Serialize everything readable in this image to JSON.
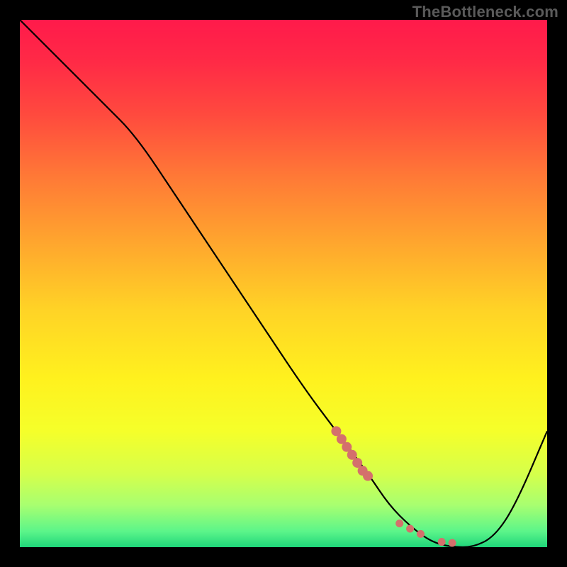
{
  "watermark": "TheBottleneck.com",
  "colors": {
    "bg_black": "#000000",
    "curve": "#000000",
    "marker": "#d4706c",
    "gradient_stops": [
      {
        "offset": 0.0,
        "color": "#ff1a4b"
      },
      {
        "offset": 0.08,
        "color": "#ff2a46"
      },
      {
        "offset": 0.18,
        "color": "#ff4a3e"
      },
      {
        "offset": 0.3,
        "color": "#ff7a36"
      },
      {
        "offset": 0.42,
        "color": "#ffa52e"
      },
      {
        "offset": 0.55,
        "color": "#ffd326"
      },
      {
        "offset": 0.68,
        "color": "#fff11e"
      },
      {
        "offset": 0.78,
        "color": "#f5ff2a"
      },
      {
        "offset": 0.86,
        "color": "#d6ff4a"
      },
      {
        "offset": 0.92,
        "color": "#a8ff70"
      },
      {
        "offset": 0.97,
        "color": "#5cf58a"
      },
      {
        "offset": 1.0,
        "color": "#1fd67a"
      }
    ]
  },
  "chart_data": {
    "type": "line",
    "title": "",
    "xlabel": "",
    "ylabel": "",
    "xlim": [
      0,
      100
    ],
    "ylim": [
      0,
      100
    ],
    "series": [
      {
        "name": "bottleneck-curve",
        "x": [
          0,
          8,
          16,
          22,
          30,
          38,
          46,
          54,
          60,
          66,
          70,
          74,
          78,
          82,
          86,
          90,
          94,
          100
        ],
        "y": [
          100,
          92,
          84,
          78,
          66,
          54,
          42,
          30,
          22,
          14,
          8,
          4,
          1,
          0,
          0,
          2,
          8,
          22
        ]
      }
    ],
    "markers": {
      "name": "highlight-dots",
      "x": [
        60,
        61,
        62,
        63,
        64,
        65,
        66,
        72,
        74,
        76,
        80,
        82
      ],
      "y": [
        22,
        20.5,
        19,
        17.5,
        16,
        14.5,
        13.5,
        4.5,
        3.5,
        2.5,
        1,
        0.8
      ]
    }
  }
}
